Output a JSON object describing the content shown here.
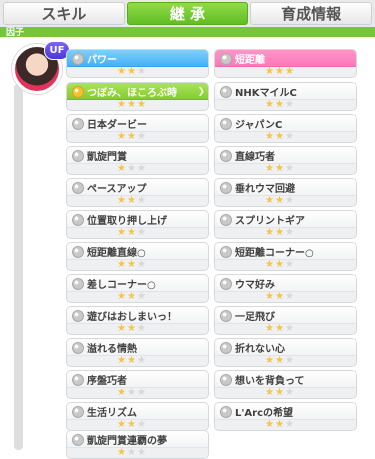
{
  "tabs": [
    {
      "label": "スキル",
      "active": false
    },
    {
      "label": "継 承",
      "active": true
    },
    {
      "label": "育成情報",
      "active": false
    }
  ],
  "section": {
    "title": "因子"
  },
  "avatar_badge": "UF",
  "cards": [
    {
      "name": "パワー",
      "stars": 2,
      "style": "blue"
    },
    {
      "name": "短距離",
      "stars": 3,
      "style": "pink"
    },
    {
      "name": "つぼみ、ほころぶ時",
      "stars": 3,
      "style": "green"
    },
    {
      "name": "NHKマイルC",
      "stars": 2,
      "style": "white"
    },
    {
      "name": "日本ダービー",
      "stars": 2,
      "style": "white"
    },
    {
      "name": "ジャパンC",
      "stars": 2,
      "style": "white"
    },
    {
      "name": "凱旋門賞",
      "stars": 1,
      "style": "white"
    },
    {
      "name": "直線巧者",
      "stars": 2,
      "style": "white"
    },
    {
      "name": "ペースアップ",
      "stars": 2,
      "style": "white"
    },
    {
      "name": "垂れウマ回避",
      "stars": 2,
      "style": "white"
    },
    {
      "name": "位置取り押し上げ",
      "stars": 2,
      "style": "white"
    },
    {
      "name": "スプリントギア",
      "stars": 2,
      "style": "white"
    },
    {
      "name": "短距離直線○",
      "stars": 2,
      "style": "white"
    },
    {
      "name": "短距離コーナー○",
      "stars": 2,
      "style": "white"
    },
    {
      "name": "差しコーナー○",
      "stars": 2,
      "style": "white"
    },
    {
      "name": "ウマ好み",
      "stars": 2,
      "style": "white"
    },
    {
      "name": "遊びはおしまいっ！",
      "stars": 2,
      "style": "white"
    },
    {
      "name": "一足飛び",
      "stars": 2,
      "style": "white"
    },
    {
      "name": "溢れる情熱",
      "stars": 2,
      "style": "white"
    },
    {
      "name": "折れない心",
      "stars": 2,
      "style": "white"
    },
    {
      "name": "序盤巧者",
      "stars": 1,
      "style": "white"
    },
    {
      "name": "想いを背負って",
      "stars": 2,
      "style": "white"
    },
    {
      "name": "生活リズム",
      "stars": 2,
      "style": "white"
    },
    {
      "name": "L'Arcの希望",
      "stars": 2,
      "style": "white"
    },
    {
      "name": "凱旋門賞連覇の夢",
      "stars": 1,
      "style": "white"
    }
  ]
}
